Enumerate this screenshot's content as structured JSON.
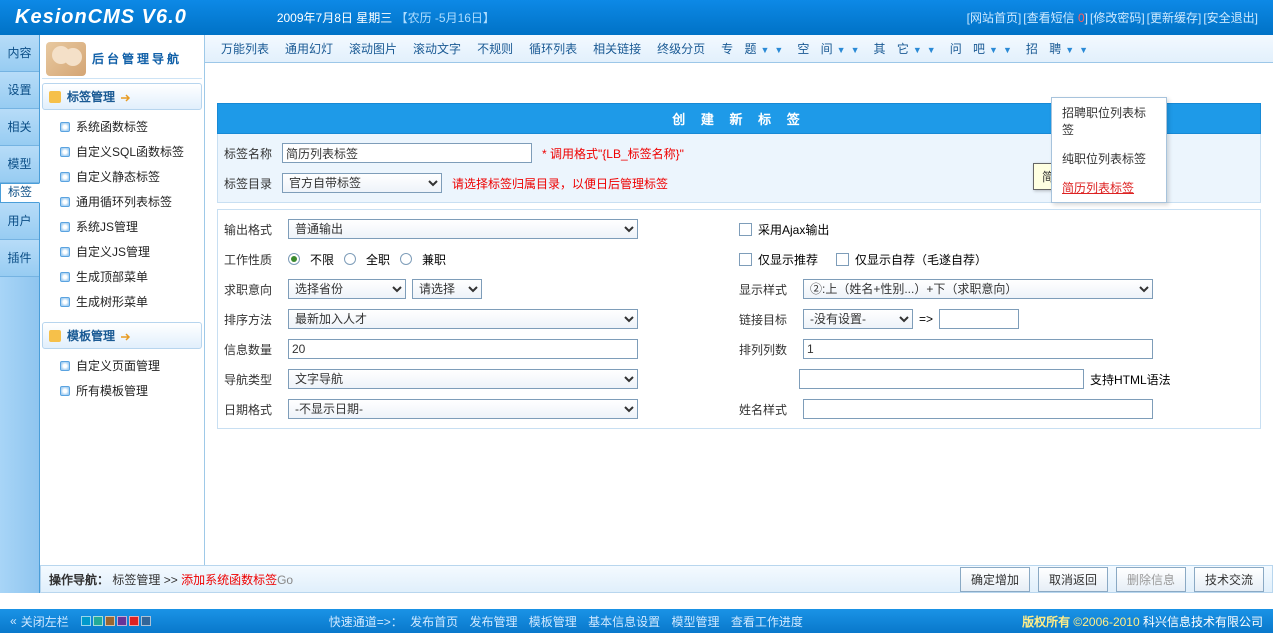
{
  "brand": "KesionCMS V6.0",
  "date": {
    "text": "2009年7月8日 星期三",
    "lunar": "【农历 -5月16日】"
  },
  "toplinks": {
    "home": "[网站首页]",
    "sms_l": "[查看短信 ",
    "sms_n": "0",
    "sms_r": "]",
    "pwd": "[修改密码]",
    "cache": "[更新缓存]",
    "exit": "[安全退出]"
  },
  "nav_title": "后台管理导航",
  "left_tabs": [
    "内容",
    "设置",
    "相关",
    "模型",
    "标签",
    "用户",
    "插件"
  ],
  "side_groups": {
    "g1": {
      "title": "标签管理",
      "items": [
        "系统函数标签",
        "自定义SQL函数标签",
        "自定义静态标签",
        "通用循环列表标签",
        "系统JS管理",
        "自定义JS管理",
        "生成顶部菜单",
        "生成树形菜单"
      ]
    },
    "g2": {
      "title": "模板管理",
      "items": [
        "自定义页面管理",
        "所有模板管理"
      ]
    }
  },
  "tabs": {
    "plain": [
      "万能列表",
      "通用幻灯",
      "滚动图片",
      "滚动文字",
      "不规则",
      "循环列表",
      "相关链接",
      "终级分页"
    ],
    "drop": [
      "专 题",
      "空 间",
      "其 它",
      "问 吧",
      "招 聘"
    ]
  },
  "dropdown": {
    "i1": "招聘职位列表标签",
    "i2": "纯职位列表标签",
    "i3": "简历列表标签"
  },
  "tooltip": "简历列表标签",
  "panel_title": "创 建 新 标 签",
  "form": {
    "r1": {
      "lbl": "标签名称",
      "val": "简历列表标签",
      "hint": "* 调用格式\"{LB_标签名称}\""
    },
    "r2": {
      "lbl": "标签目录",
      "val": "官方自带标签",
      "hint": "请选择标签归属目录，以便日后管理标签"
    },
    "r3": {
      "lbl": "输出格式",
      "val": "普通输出",
      "cb": "采用Ajax输出"
    },
    "r4": {
      "lbl": "工作性质",
      "o1": "不限",
      "o2": "全职",
      "o3": "兼职",
      "cb1": "仅显示推荐",
      "cb2": "仅显示自荐（毛遂自荐）"
    },
    "r5": {
      "lbl": "求职意向",
      "s1": "选择省份",
      "s2": "请选择",
      "lbl2": "显示样式",
      "s3": "②:上（姓名+性别...）+下（求职意向）"
    },
    "r6": {
      "lbl": "排序方法",
      "val": "最新加入人才",
      "lbl2": "链接目标",
      "val2": "-没有设置-",
      "eq": "=>"
    },
    "r7": {
      "lbl": "信息数量",
      "val": "20",
      "lbl2": "排列列数",
      "val2": "1"
    },
    "r8": {
      "lbl": "导航类型",
      "val": "文字导航",
      "suffix": "支持HTML语法"
    },
    "r9": {
      "lbl": "日期格式",
      "val": "-不显示日期-",
      "lbl2": "姓名样式"
    }
  },
  "footer": {
    "crumb_l": "操作导航：",
    "crumb_a": "标签管理",
    "arrow": " >> ",
    "crumb_b": "添加系统函数标签",
    "go": "Go",
    "btn_ok": "确定增加",
    "btn_cancel": "取消返回",
    "btn_del": "删除信息",
    "btn_tech": "技术交流"
  },
  "bottom": {
    "close": "关闭左栏",
    "quick_lbl": "快速通道=>：",
    "q": [
      "发布首页",
      "发布管理",
      "模板管理",
      "基本信息设置",
      "模型管理",
      "查看工作进度"
    ],
    "copy_l": "版权所有 ",
    "copy_y": "©2006-2010",
    "copy_c": " 科兴信息技术有限公司"
  }
}
